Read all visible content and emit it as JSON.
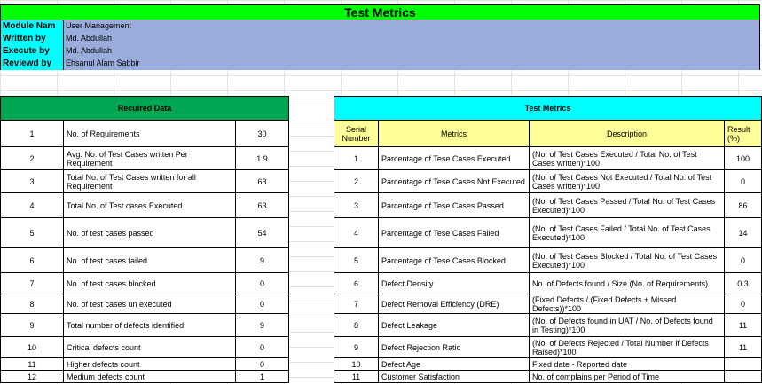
{
  "title": "Test Metrics",
  "info": [
    {
      "label": "Module Nam",
      "value": "User Management"
    },
    {
      "label": "Written by",
      "value": "Md. Abdullah"
    },
    {
      "label": "Execute by",
      "value": "Md. Abdullah"
    },
    {
      "label": "Reviewd by",
      "value": "Ehsanul Alam Sabbir"
    }
  ],
  "required": {
    "header": "Recuired Data",
    "rows": [
      {
        "no": "1",
        "label": "No. of Requirements",
        "value": "30"
      },
      {
        "no": "2",
        "label": "Avg. No. of Test Cases written Per Requirement",
        "value": "1.9"
      },
      {
        "no": "3",
        "label": "Total No. of Test Cases written for all Requirement",
        "value": "63"
      },
      {
        "no": "4",
        "label": "Total No. of Test cases Executed",
        "value": "63"
      },
      {
        "no": "5",
        "label": "No. of test cases passed",
        "value": "54"
      },
      {
        "no": "6",
        "label": "No. of test cases failed",
        "value": "9"
      },
      {
        "no": "7",
        "label": "No. of test cases blocked",
        "value": "0"
      },
      {
        "no": "8",
        "label": "No. of test cases un executed",
        "value": "0"
      },
      {
        "no": "9",
        "label": "Total number of defects identified",
        "value": "9"
      },
      {
        "no": "10",
        "label": "Critical defects count",
        "value": "0"
      },
      {
        "no": "11",
        "label": "Higher defects count",
        "value": "0"
      },
      {
        "no": "12",
        "label": "Medium defects count",
        "value": "1"
      }
    ]
  },
  "metrics": {
    "header": "Test Metrics",
    "columns": {
      "serial": "Serial Number",
      "metric": "Metrics",
      "description": "Description",
      "result": "Result (%)"
    },
    "rows": [
      {
        "no": "1",
        "metric": "Parcentage of Tese Cases Executed",
        "description": "(No. of Test Cases Executed / Total No. of Test Cases written)*100",
        "result": "100"
      },
      {
        "no": "2",
        "metric": "Parcentage of Tese Cases Not Executed",
        "description": "(No. of Test Cases Not Executed / Total No. of Test Cases written)*100",
        "result": "0"
      },
      {
        "no": "3",
        "metric": "Parcentage of Tese Cases Passed",
        "description": "(No. of Test Cases Passed / Total No. of Test Cases Executed)*100",
        "result": "86"
      },
      {
        "no": "4",
        "metric": "Parcentage of Tese Cases Failed",
        "description": "(No. of Test Cases Failed / Total No. of Test Cases Executed)*100",
        "result": "14"
      },
      {
        "no": "5",
        "metric": "Parcentage of Tese Cases Blocked",
        "description": "(No. of Test Cases Blocked / Total No. of Test Cases Executed)*100",
        "result": "0"
      },
      {
        "no": "6",
        "metric": "Defect Density",
        "description": "No. of Defects found / Size (No. of Requirements)",
        "result": "0.3"
      },
      {
        "no": "7",
        "metric": "Defect Removal Efficiency (DRE)",
        "description": "(Fixed Defects / (Fixed Defects + Missed Defects))*100",
        "result": "0"
      },
      {
        "no": "8",
        "metric": "Defect Leakage",
        "description": "(No. of Defects found in UAT / No. of Defects found in Testing)*100",
        "result": "11"
      },
      {
        "no": "9",
        "metric": "Defect Rejection Ratio",
        "description": "(No. of Defects Rejected / Total Number if Defects Raised)*100",
        "result": "11"
      },
      {
        "no": "10",
        "metric": "Defect Age",
        "description": "Fixed date - Reported date",
        "result": ""
      },
      {
        "no": "11",
        "metric": "Customer Satisfaction",
        "description": "No. of complains per Period of Time",
        "result": ""
      }
    ]
  },
  "colors": {
    "title_bg": "#00ff00",
    "label_bg": "#00ffff",
    "value_bg": "#99acdc",
    "green_header": "#00a651",
    "cyan_header": "#00ffff",
    "yellow_header": "#ffff99"
  }
}
